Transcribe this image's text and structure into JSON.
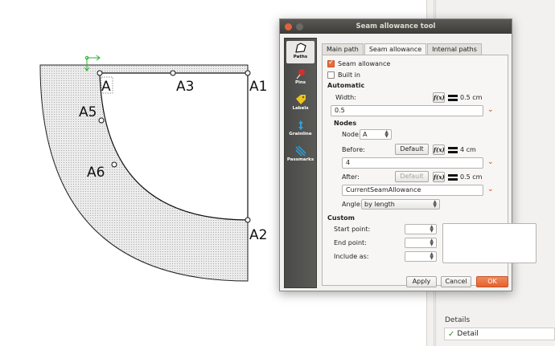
{
  "canvas": {
    "points": [
      "A",
      "A3",
      "A1",
      "A5",
      "A6",
      "A2"
    ]
  },
  "dialog": {
    "title": "Seam allowance tool",
    "sidebar": [
      "Paths",
      "Pins",
      "Labels",
      "Grainline",
      "Passmarks"
    ],
    "tabs": [
      "Main path",
      "Seam allowance",
      "Internal paths"
    ],
    "seam_allowance_label": "Seam allowance",
    "built_in_label": "Built in",
    "automatic_title": "Automatic",
    "width_label": "Width:",
    "width_value": "0.5 cm",
    "width_formula": "0.5",
    "nodes_title": "Nodes",
    "node_label": "Node:",
    "node_value": "A",
    "before_label": "Before:",
    "before_value": "4 cm",
    "before_formula": "4",
    "after_label": "After:",
    "after_value": "0.5 cm",
    "after_formula": "CurrentSeamAllowance",
    "angle_label": "Angle:",
    "angle_value": "by length",
    "default_label": "Default",
    "fx_label": "f(x)",
    "custom_title": "Custom",
    "start_point_label": "Start point:",
    "end_point_label": "End point:",
    "include_as_label": "Include as:",
    "apply_label": "Apply",
    "cancel_label": "Cancel",
    "ok_label": "OK"
  },
  "details": {
    "title": "Details",
    "row_label": "Detail"
  },
  "colors": {
    "accent": "#e5622d",
    "titlebar": "#3d3c38",
    "sidebar": "#4a4a48"
  }
}
